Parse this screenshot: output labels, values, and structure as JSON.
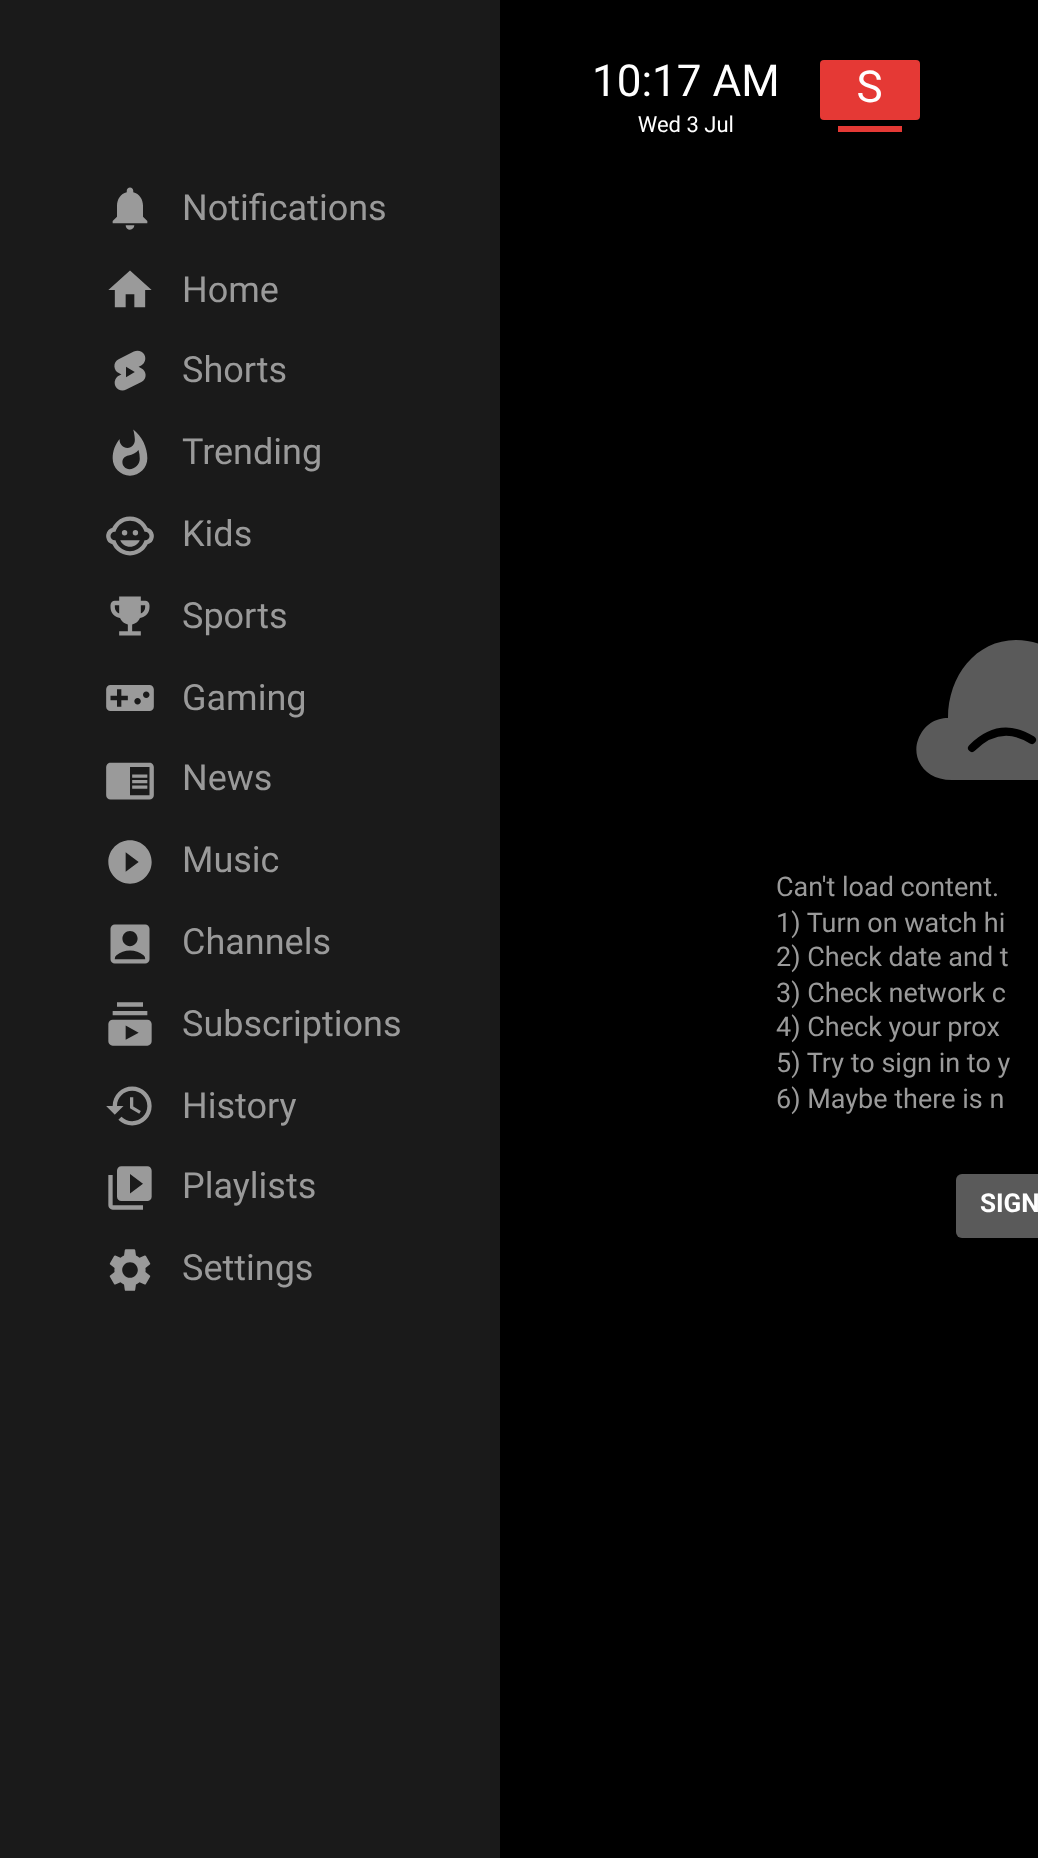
{
  "sidebar": {
    "items": [
      {
        "label": "Notifications"
      },
      {
        "label": "Home"
      },
      {
        "label": "Shorts"
      },
      {
        "label": "Trending"
      },
      {
        "label": "Kids"
      },
      {
        "label": "Sports"
      },
      {
        "label": "Gaming"
      },
      {
        "label": "News"
      },
      {
        "label": "Music"
      },
      {
        "label": "Channels"
      },
      {
        "label": "Subscriptions"
      },
      {
        "label": "History"
      },
      {
        "label": "Playlists"
      },
      {
        "label": "Settings"
      }
    ]
  },
  "header": {
    "time": "10:17 AM",
    "date": "Wed 3 Jul",
    "logo_letter": "S"
  },
  "error": {
    "lines": [
      "Can't load content.",
      "1) Turn on watch hi",
      "2) Check date and t",
      "3) Check network c",
      "4) Check your prox",
      "5) Try to sign in to y",
      "6) Maybe there is n"
    ],
    "button": "SIGN"
  }
}
